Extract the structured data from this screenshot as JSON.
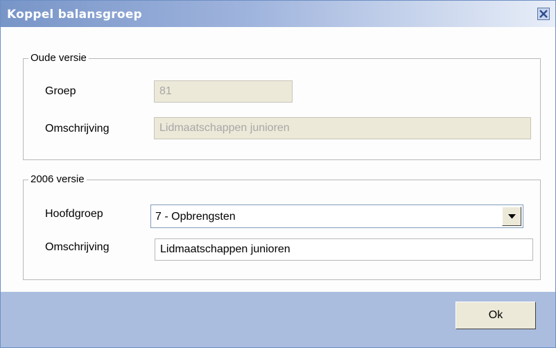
{
  "window": {
    "title": "Koppel balansgroep",
    "close_icon": "close-icon"
  },
  "old_version": {
    "legend": "Oude versie",
    "groep_label": "Groep",
    "groep_value": "81",
    "omschrijving_label": "Omschrijving",
    "omschrijving_value": "Lidmaatschappen junioren"
  },
  "new_version": {
    "legend": "2006 versie",
    "hoofdgroep_label": "Hoofdgroep",
    "hoofdgroep_value": "7 - Opbrengsten",
    "omschrijving_label": "Omschrijving",
    "omschrijving_value": "Lidmaatschappen junioren"
  },
  "footer": {
    "ok_label": "Ok"
  },
  "colors": {
    "titlebar_start": "#7895c8",
    "footer_bg": "#aabddf",
    "disabled_field": "#ece9d8"
  }
}
